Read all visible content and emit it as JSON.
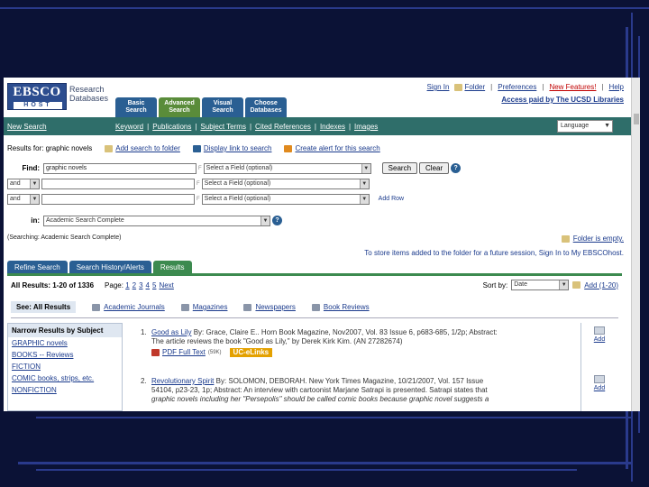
{
  "header": {
    "logo_main": "EBSCO",
    "logo_sub": "HOST",
    "logo_text_1": "Research",
    "logo_text_2": "Databases",
    "tabs": [
      {
        "line1": "Basic",
        "line2": "Search"
      },
      {
        "line1": "Advanced",
        "line2": "Search"
      },
      {
        "line1": "Visual",
        "line2": "Search"
      },
      {
        "line1": "Choose",
        "line2": "Databases"
      }
    ],
    "top_links": {
      "sign_in": "Sign In",
      "folder": "Folder",
      "preferences": "Preferences",
      "new_features": "New Features!",
      "help": "Help"
    },
    "access": "Access paid by The UCSD Libraries"
  },
  "navbar": {
    "new_search": "New Search",
    "links": [
      "Keyword",
      "Publications",
      "Subject Terms",
      "Cited References",
      "Indexes",
      "Images"
    ],
    "language": "Language"
  },
  "results_line": {
    "results_for": "Results for: graphic novels",
    "add_search": "Add search to folder",
    "display_link": "Display link to search",
    "create_alert": "Create alert for this search"
  },
  "search": {
    "find_label": "Find:",
    "query": "graphic novels",
    "field_placeholder": "Select a Field (optional)",
    "bool": "and",
    "search_btn": "Search",
    "clear_btn": "Clear",
    "add_row": "Add Row",
    "in_label": "in:",
    "database": "Academic Search Complete",
    "scoping": "(Searching: Academic Search Complete)"
  },
  "folder": {
    "empty": "Folder is empty.",
    "store": "To store items added to the folder for a future session, Sign In to My EBSCOhost."
  },
  "result_tabs": [
    "Refine Search",
    "Search History/Alerts",
    "Results"
  ],
  "results": {
    "all_results": "All Results: 1-20 of 1336",
    "page_label": "Page:",
    "pages": [
      "1",
      "2",
      "3",
      "4",
      "5"
    ],
    "next": "Next",
    "sort_label": "Sort by:",
    "sort_value": "Date",
    "add_range": "Add (1-20)",
    "see_all": "See: All Results",
    "filters": [
      "Academic Journals",
      "Magazines",
      "Newspapers",
      "Book Reviews"
    ]
  },
  "narrow": {
    "heading": "Narrow Results by Subject",
    "items": [
      "GRAPHIC novels",
      "BOOKS -- Reviews",
      "FICTION",
      "COMIC books, strips, etc.",
      "NONFICTION"
    ]
  },
  "items": [
    {
      "num": "1.",
      "title": "Good as Lily",
      "text1": "By: Grace, Claire E.. Horn Book Magazine, Nov2007, Vol. 83 Issue 6, p683-685, 1/2p; Abstract:",
      "text2": "The article reviews the book \"Good as Lily,\" by Derek Kirk Kim. (AN 27282674)",
      "pdf": "PDF Full Text",
      "pdf_size": "(59K)",
      "uclinks": "UC-eLinks",
      "add": "Add"
    },
    {
      "num": "2.",
      "title": "Revolutionary Spirit",
      "text1": "By: SOLOMON, DEBORAH. New York Times Magazine, 10/21/2007, Vol. 157 Issue",
      "text2": "54104, p23-23, 1p; Abstract: An interview with cartoonist Marjane Satrapi is presented. Satrapi states that",
      "text3": "graphic novels including her \"Persepolis\" should be called comic books because graphic novel suggests a",
      "add": "Add"
    }
  ],
  "colors": {
    "navbar": "#2f6e6a",
    "tab_blue": "#2a5f93",
    "tab_green": "#5a8c3a",
    "link": "#1a3a8c",
    "background": "#0b1236"
  }
}
